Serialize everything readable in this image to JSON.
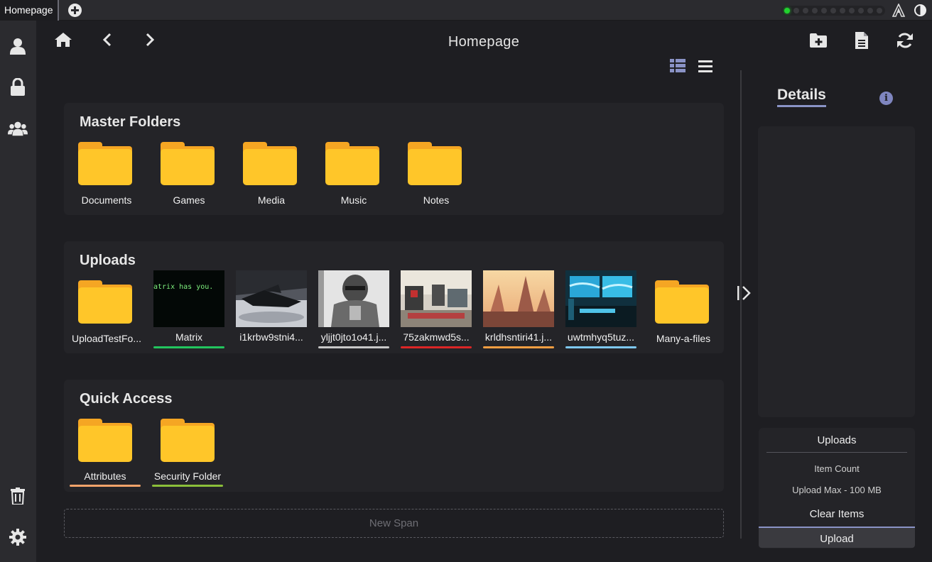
{
  "tab": {
    "title": "Homepage"
  },
  "status_leds": {
    "total": 11,
    "active": 1,
    "active_color": "#21d32e"
  },
  "page": {
    "title": "Homepage"
  },
  "sections": {
    "master": {
      "title": "Master Folders",
      "items": [
        "Documents",
        "Games",
        "Media",
        "Music",
        "Notes"
      ]
    },
    "uploads": {
      "title": "Uploads",
      "items": [
        {
          "label": "UploadTestFo...",
          "type": "folder"
        },
        {
          "label": "Matrix",
          "type": "image",
          "underline": "#22c55e",
          "caption": "atrix has you."
        },
        {
          "label": "i1krbw9stni4...",
          "type": "image",
          "underline": ""
        },
        {
          "label": "yljjt0jto1o41.j...",
          "type": "image",
          "underline": "#c8c8c8"
        },
        {
          "label": "75zakmwd5s...",
          "type": "image",
          "underline": "#dc2626"
        },
        {
          "label": "krldhsntiri41.j...",
          "type": "image",
          "underline": "#f59e42"
        },
        {
          "label": "uwtmhyq5tuz...",
          "type": "image",
          "underline": "#7ec8f0"
        },
        {
          "label": "Many-a-files",
          "type": "folder"
        }
      ]
    },
    "quick": {
      "title": "Quick Access",
      "items": [
        {
          "label": "Attributes",
          "underline": "#f5a36a"
        },
        {
          "label": "Security Folder",
          "underline": "#8bbf3a"
        }
      ]
    }
  },
  "new_span": {
    "label": "New Span"
  },
  "details": {
    "title": "Details",
    "upload_panel": {
      "title": "Uploads",
      "item_count": "Item Count",
      "upload_max": "Upload Max - 100 MB",
      "clear": "Clear Items",
      "upload": "Upload"
    }
  },
  "icons": {
    "sidebar": [
      "user-icon",
      "lock-icon",
      "users-icon",
      "trash-icon",
      "gear-icon"
    ],
    "toolbar": [
      "home-icon",
      "chevron-left-icon",
      "chevron-right-icon",
      "new-folder-icon",
      "new-file-icon",
      "refresh-icon",
      "grid-view-icon",
      "list-view-icon"
    ]
  },
  "colors": {
    "folder": "#ffc629",
    "accent": "#8a93c6",
    "background": "#1e1e22"
  }
}
